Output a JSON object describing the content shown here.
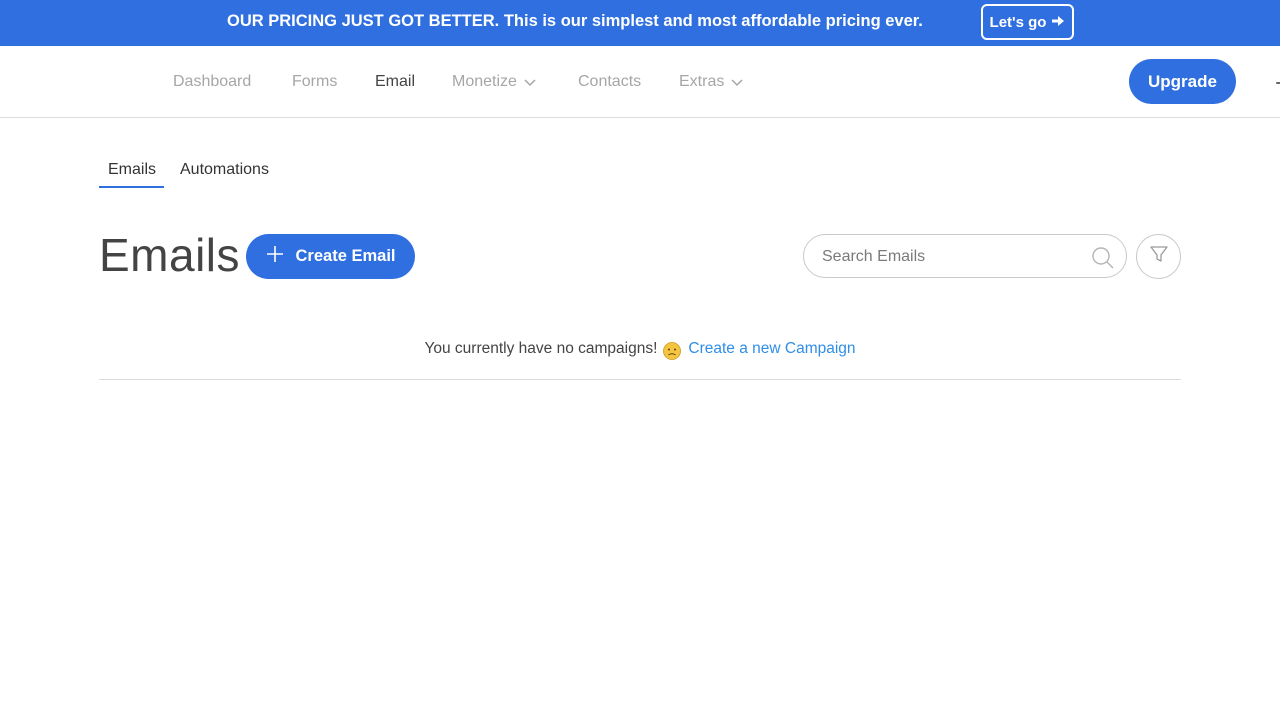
{
  "banner": {
    "text": "OUR PRICING JUST GOT BETTER. This is our simplest and most affordable pricing ever.",
    "cta_label": "Let's go",
    "cta_icon": "arrow-right-icon"
  },
  "nav": {
    "items": [
      {
        "label": "Dashboard",
        "active": false,
        "dropdown": false
      },
      {
        "label": "Forms",
        "active": false,
        "dropdown": false
      },
      {
        "label": "Email",
        "active": true,
        "dropdown": false
      },
      {
        "label": "Monetize",
        "active": false,
        "dropdown": true
      },
      {
        "label": "Contacts",
        "active": false,
        "dropdown": false
      },
      {
        "label": "Extras",
        "active": false,
        "dropdown": true
      }
    ],
    "upgrade_label": "Upgrade"
  },
  "subtabs": [
    {
      "label": "Emails",
      "active": true
    },
    {
      "label": "Automations",
      "active": false
    }
  ],
  "main": {
    "title": "Emails",
    "create_label": "Create Email",
    "search_placeholder": "Search Emails",
    "search_value": "",
    "empty_message": "You currently have no campaigns!",
    "empty_emoji": "disappointed-face-icon",
    "empty_link": "Create a new Campaign"
  },
  "colors": {
    "accent": "#2f6fdf",
    "link": "#2f8ee8",
    "nav_inactive": "#a6a6a6",
    "nav_active": "#444444"
  }
}
